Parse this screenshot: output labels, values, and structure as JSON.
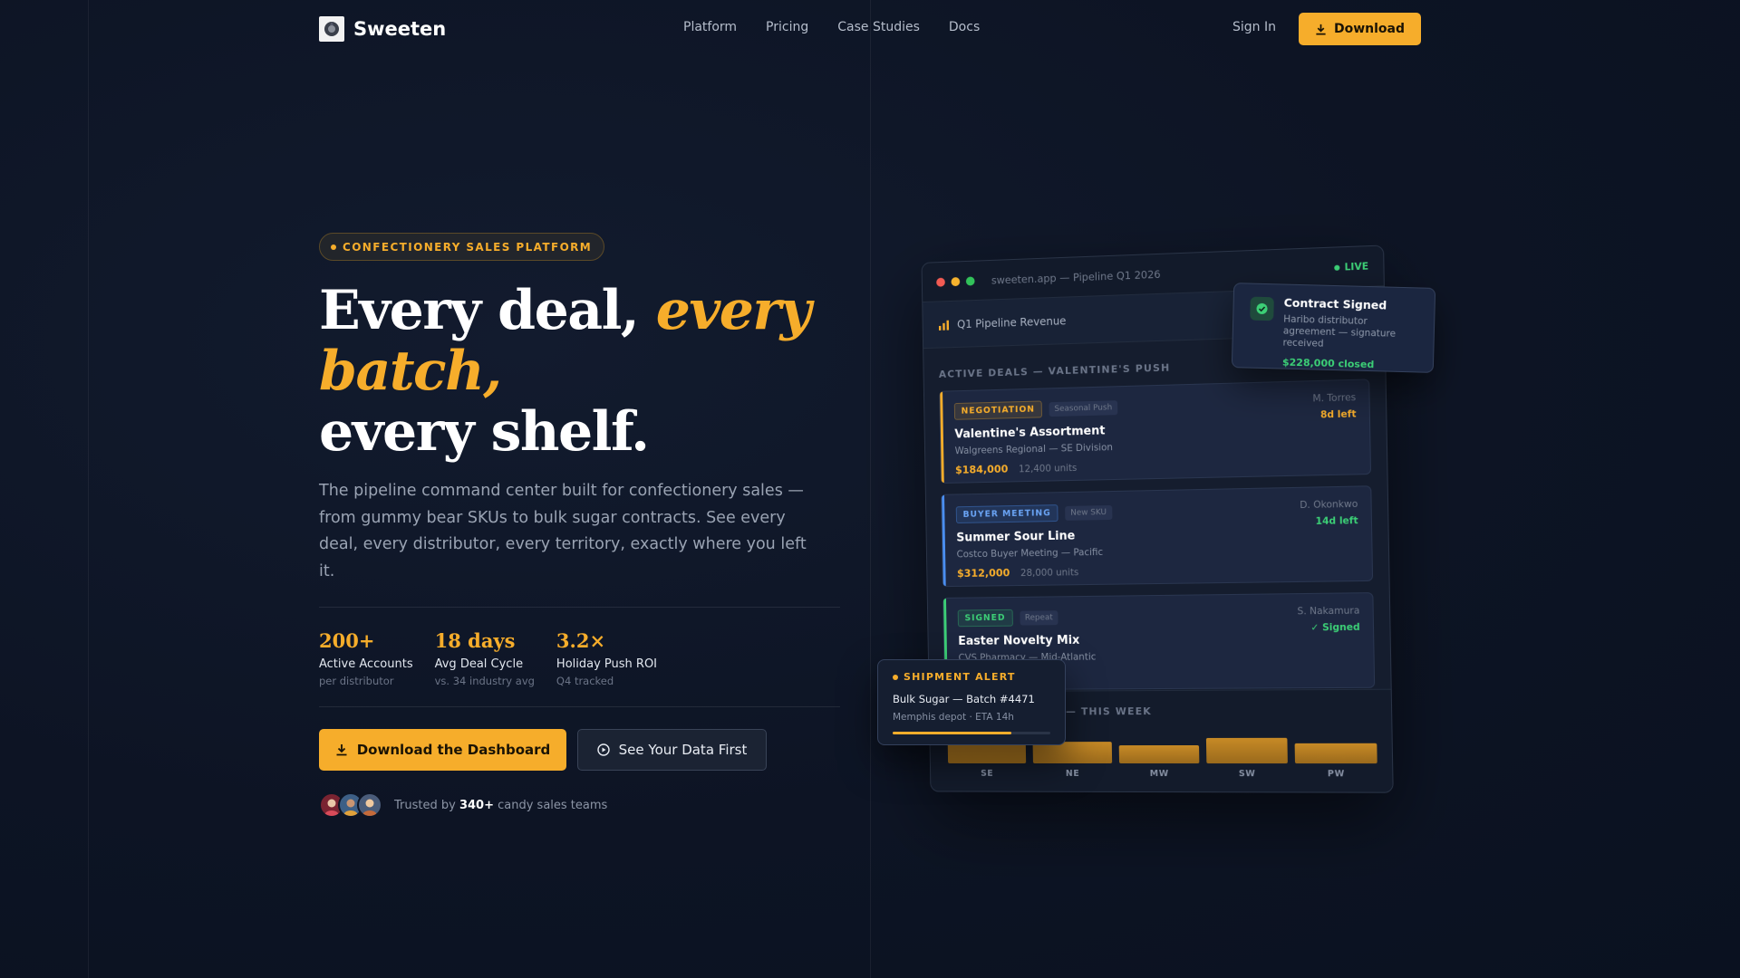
{
  "colors": {
    "accent": "#f6ad2b",
    "background": "#0d1424",
    "success": "#3ccf76",
    "info": "#4a8ef0"
  },
  "nav": {
    "brand": "Sweeten",
    "brand_icon": "candy-logo-icon",
    "links": [
      "Platform",
      "Pricing",
      "Case Studies",
      "Docs"
    ],
    "sign_in": "Sign In",
    "download": "Download"
  },
  "hero": {
    "badge": "CONFECTIONERY SALES PLATFORM",
    "headline_1": "Every deal, ",
    "headline_accent_1": "every",
    "headline_accent_2": "batch,",
    "headline_3": "every shelf.",
    "subtext": "The pipeline command center built for confectionery sales — from gummy bear SKUs to bulk sugar contracts. See every deal, every distributor, every territory, exactly where you left it.",
    "stats": [
      {
        "value": "200+",
        "label": "Active Accounts",
        "sub": "per distributor"
      },
      {
        "value": "18 days",
        "label": "Avg Deal Cycle",
        "sub": "vs. 34 industry avg"
      },
      {
        "value": "3.2×",
        "label": "Holiday Push ROI",
        "sub": "Q4 tracked"
      }
    ],
    "primary_cta": "Download the Dashboard",
    "secondary_cta": "See Your Data First",
    "trusted_prefix": "Trusted by ",
    "trusted_count": "340+",
    "trusted_suffix": " candy sales teams"
  },
  "dashboard": {
    "url": "sweeten.app — Pipeline Q1 2026",
    "live": "LIVE",
    "revenue_label": "Q1 Pipeline Revenue",
    "section_title": "ACTIVE DEALS — VALENTINE'S PUSH",
    "deals": [
      {
        "stage": "NEGOTIATION",
        "tag": "Seasonal Push",
        "owner": "M. Torres",
        "due": "8d left",
        "name": "Valentine's Assortment",
        "client": "Walgreens Regional — SE Division",
        "amount": "$184,000",
        "units": "12,400 units"
      },
      {
        "stage": "BUYER MEETING",
        "tag": "New SKU",
        "owner": "D. Okonkwo",
        "due": "14d left",
        "name": "Summer Sour Line",
        "client": "Costco Buyer Meeting — Pacific",
        "amount": "$312,000",
        "units": "28,000 units"
      },
      {
        "stage": "SIGNED",
        "tag": "Repeat",
        "owner": "S. Nakamura",
        "due": "✓ Signed",
        "name": "Easter Novelty Mix",
        "client": "CVS Pharmacy — Mid-Atlantic",
        "amount": "",
        "units": ""
      }
    ],
    "territory_title": "— THIS WEEK",
    "territory_bars": [
      {
        "label": "SE",
        "value": 0.62
      },
      {
        "label": "NE",
        "value": 0.6
      },
      {
        "label": "MW",
        "value": 0.5
      },
      {
        "label": "SW",
        "value": 0.7
      },
      {
        "label": "PW",
        "value": 0.55
      }
    ]
  },
  "toast": {
    "title": "Contract Signed",
    "body": "Haribo distributor agreement — signature received",
    "amount": "$228,000 closed"
  },
  "alert": {
    "title": "SHIPMENT ALERT",
    "name": "Bulk Sugar — Batch #4471",
    "sub": "Memphis depot · ETA 14h",
    "progress": 0.75
  }
}
